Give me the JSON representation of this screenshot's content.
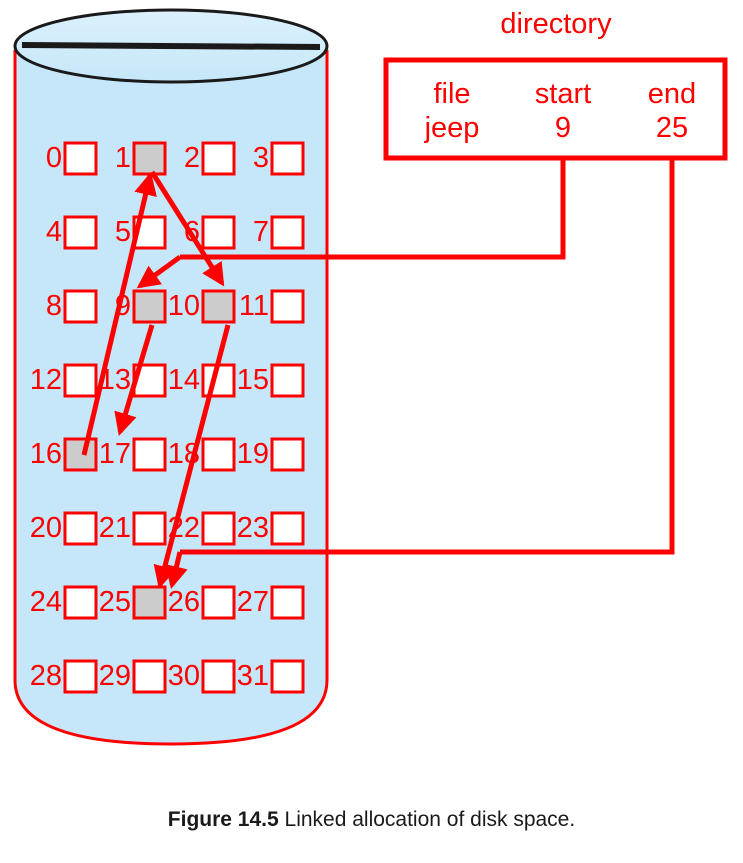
{
  "figure": {
    "caption_label": "Figure 14.5",
    "caption_text": "Linked allocation of disk space.",
    "colors": {
      "accent_red": "#ff0000",
      "disk_fill": "#c5e7f9",
      "disk_top_fill": "#d3edfb",
      "allocated_block_fill": "#cccccc",
      "free_block_fill": "#ffffff",
      "outline_black": "#1a1a1a"
    }
  },
  "directory": {
    "title": "directory",
    "headers": [
      "file",
      "start",
      "end"
    ],
    "rows": [
      {
        "file": "jeep",
        "start": "9",
        "end": "25"
      }
    ]
  },
  "disk": {
    "name": "disk-cylinder",
    "total_blocks": 32,
    "columns": 4,
    "rows": 8,
    "block_labels": [
      "0",
      "1",
      "2",
      "3",
      "4",
      "5",
      "6",
      "7",
      "8",
      "9",
      "10",
      "11",
      "12",
      "13",
      "14",
      "15",
      "16",
      "17",
      "18",
      "19",
      "20",
      "21",
      "22",
      "23",
      "24",
      "25",
      "26",
      "27",
      "28",
      "29",
      "30",
      "31"
    ],
    "allocated_blocks": [
      1,
      9,
      10,
      16,
      25
    ]
  },
  "chain": {
    "description": "linked allocation chain for file jeep",
    "order": [
      9,
      16,
      1,
      10,
      25
    ],
    "links": [
      {
        "from": 9,
        "to": 16
      },
      {
        "from": 16,
        "to": 1
      },
      {
        "from": 1,
        "to": 10
      },
      {
        "from": 10,
        "to": 25
      }
    ],
    "pointers": [
      {
        "source": "start",
        "value": "9",
        "target_block": 9
      },
      {
        "source": "end",
        "value": "25",
        "target_block": 25
      }
    ]
  }
}
